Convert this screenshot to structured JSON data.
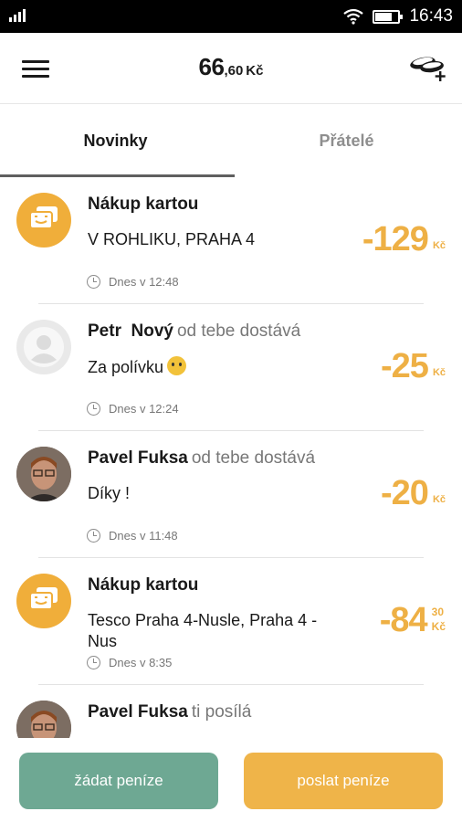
{
  "status_bar": {
    "time": "16:43",
    "battery_level": 0.75
  },
  "header": {
    "balance_whole": "66",
    "balance_decimal": ",60",
    "currency": "Kč",
    "menu_icon": "hamburger-menu-icon",
    "coins_icon": "coins-add-icon"
  },
  "tabs": [
    {
      "label": "Novinky",
      "active": true
    },
    {
      "label": "Přátelé",
      "active": false
    }
  ],
  "feed": [
    {
      "title": "Nákup kartou",
      "subtitle": "",
      "description": "V ROHLIKU, PRAHA 4",
      "time": "Dnes v 12:48",
      "amount": "-129",
      "amount_decimals": "",
      "currency": "Kč",
      "avatar": "card-icon"
    },
    {
      "title": "Petr  Nový",
      "subtitle": "od tebe dostává",
      "description": "Za polívku",
      "time": "Dnes v 12:24",
      "amount": "-25",
      "amount_decimals": "",
      "currency": "Kč",
      "avatar": "placeholder-avatar"
    },
    {
      "title": "Pavel Fuksa",
      "subtitle": "od tebe dostává",
      "description": "Díky !",
      "time": "Dnes v 11:48",
      "amount": "-20",
      "amount_decimals": "",
      "currency": "Kč",
      "avatar": "photo-avatar"
    },
    {
      "title": "Nákup kartou",
      "subtitle": "",
      "description": "Tesco Praha 4-Nusle, Praha 4 - Nus",
      "time": "Dnes v 8:35",
      "amount": "-84",
      "amount_decimals": "30",
      "currency": "Kč",
      "avatar": "card-icon"
    },
    {
      "title": "Pavel Fuksa",
      "subtitle": "ti posílá",
      "description": "",
      "time": "",
      "amount": "",
      "amount_decimals": "",
      "currency": "",
      "avatar": "photo-avatar"
    }
  ],
  "buttons": {
    "request": "žádat peníze",
    "send": "poslat peníze"
  },
  "colors": {
    "amount": "#eeb045",
    "card_avatar": "#f0ae3a",
    "request_button": "#6ea893",
    "send_button": "#efb449"
  }
}
